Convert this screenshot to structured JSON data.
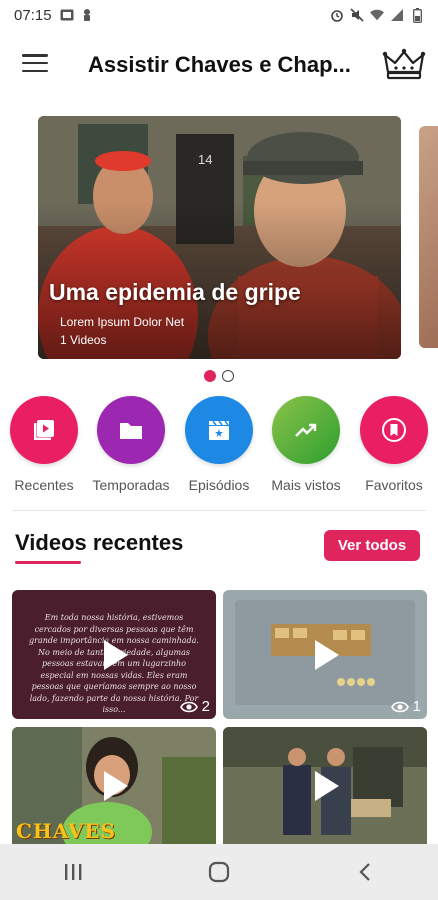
{
  "status_bar": {
    "time": "07:15",
    "left_icons": [
      "nfc-icon",
      "usb-debug-icon"
    ],
    "right_icons": [
      "alarm-icon",
      "mute-icon",
      "wifi-icon",
      "signal-icon",
      "battery-icon"
    ]
  },
  "app_bar": {
    "title": "Assistir Chaves e Chap...",
    "menu_icon": "menu-icon",
    "premium_icon": "crown-icon"
  },
  "carousel": {
    "slides": [
      {
        "title": "Uma epidemia de gripe",
        "subtitle": "Lorem Ipsum Dolor Net",
        "count": "1 Videos",
        "door_number": "14"
      }
    ],
    "active_index": 0,
    "total": 2
  },
  "categories": [
    {
      "label": "Recentes",
      "icon": "video-library-icon",
      "color": "#e91e63"
    },
    {
      "label": "Temporadas",
      "icon": "folder-icon",
      "color": "#9c27b0"
    },
    {
      "label": "Episódios",
      "icon": "movie-clapper-icon",
      "color": "#1e88e5"
    },
    {
      "label": "Mais vistos",
      "icon": "trending-up-icon",
      "color": "#4caf50"
    },
    {
      "label": "Favoritos",
      "icon": "bookmark-icon",
      "color": "#e91e63"
    }
  ],
  "recent_section": {
    "title": "Videos recentes",
    "see_all_label": "Ver todos",
    "accent": "#e0245e"
  },
  "videos": [
    {
      "views": "2",
      "overlay_text": "Em toda nossa história, estivemos cercados por diversas pessoas que têm grande importância em nossa caminhada. No meio de tanta variedade, algumas pessoas estavam em um lugarzinho especial em nossas vidas. Eles eram pessoas que queríamos sempre ao nosso lado, fazendo parte da nossa história. Por isso..."
    },
    {
      "views": "1"
    },
    {
      "views": "",
      "logo": "CHAVES"
    },
    {
      "views": ""
    }
  ],
  "nav_bar": {
    "buttons": [
      "recents-icon",
      "home-icon",
      "back-icon"
    ]
  }
}
